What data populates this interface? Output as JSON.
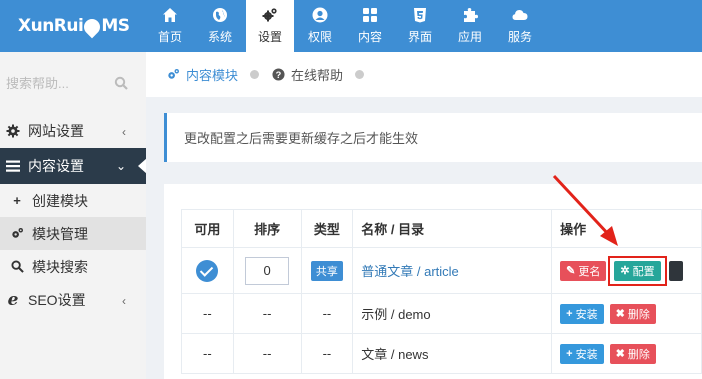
{
  "app": {
    "logo_left": "XunRui",
    "logo_right": "MS"
  },
  "topnav": [
    {
      "label": "首页",
      "icon": "home-icon",
      "active": false
    },
    {
      "label": "系统",
      "icon": "globe-icon",
      "active": false
    },
    {
      "label": "设置",
      "icon": "gears-icon",
      "active": true
    },
    {
      "label": "权限",
      "icon": "user-icon",
      "active": false
    },
    {
      "label": "内容",
      "icon": "grid-icon",
      "active": false
    },
    {
      "label": "界面",
      "icon": "html5-icon",
      "active": false
    },
    {
      "label": "应用",
      "icon": "puzzle-icon",
      "active": false
    },
    {
      "label": "服务",
      "icon": "cloud-icon",
      "active": false
    }
  ],
  "sidebar": {
    "search_placeholder": "搜索帮助...",
    "items": [
      {
        "label": "网站设置",
        "icon": "gear-icon",
        "chevron": "‹"
      },
      {
        "label": "内容设置",
        "icon": "bars-icon",
        "chevron": "⌄"
      },
      {
        "label": "创建模块",
        "icon": "plus-icon"
      },
      {
        "label": "模块管理",
        "icon": "gears-icon"
      },
      {
        "label": "模块搜索",
        "icon": "search-icon"
      },
      {
        "label": "SEO设置",
        "icon": "ie-icon",
        "chevron": "‹"
      }
    ]
  },
  "breadcrumb": {
    "tab1": "内容模块",
    "tab2": "在线帮助"
  },
  "alert": {
    "text": "更改配置之后需要更新缓存之后才能生效"
  },
  "table": {
    "headers": [
      "可用",
      "排序",
      "类型",
      "名称 / 目录",
      "操作"
    ],
    "rows": [
      {
        "enabled": "",
        "order": "0",
        "type": "共享",
        "name": "普通文章 / article",
        "ops": [
          "更名",
          "配置"
        ]
      },
      {
        "enabled": "--",
        "order": "--",
        "type": "--",
        "name": "示例 / demo",
        "ops": [
          "安装",
          "删除"
        ]
      },
      {
        "enabled": "--",
        "order": "--",
        "type": "--",
        "name": "文章 / news",
        "ops": [
          "安装",
          "删除"
        ]
      }
    ]
  },
  "colors": {
    "topbar": "#3e8ed4",
    "sidebar_active": "#2b3b4a",
    "btn_red": "#e7505a",
    "btn_green": "#26a69a",
    "btn_blue": "#3598dc",
    "highlight": "#e2231a"
  }
}
